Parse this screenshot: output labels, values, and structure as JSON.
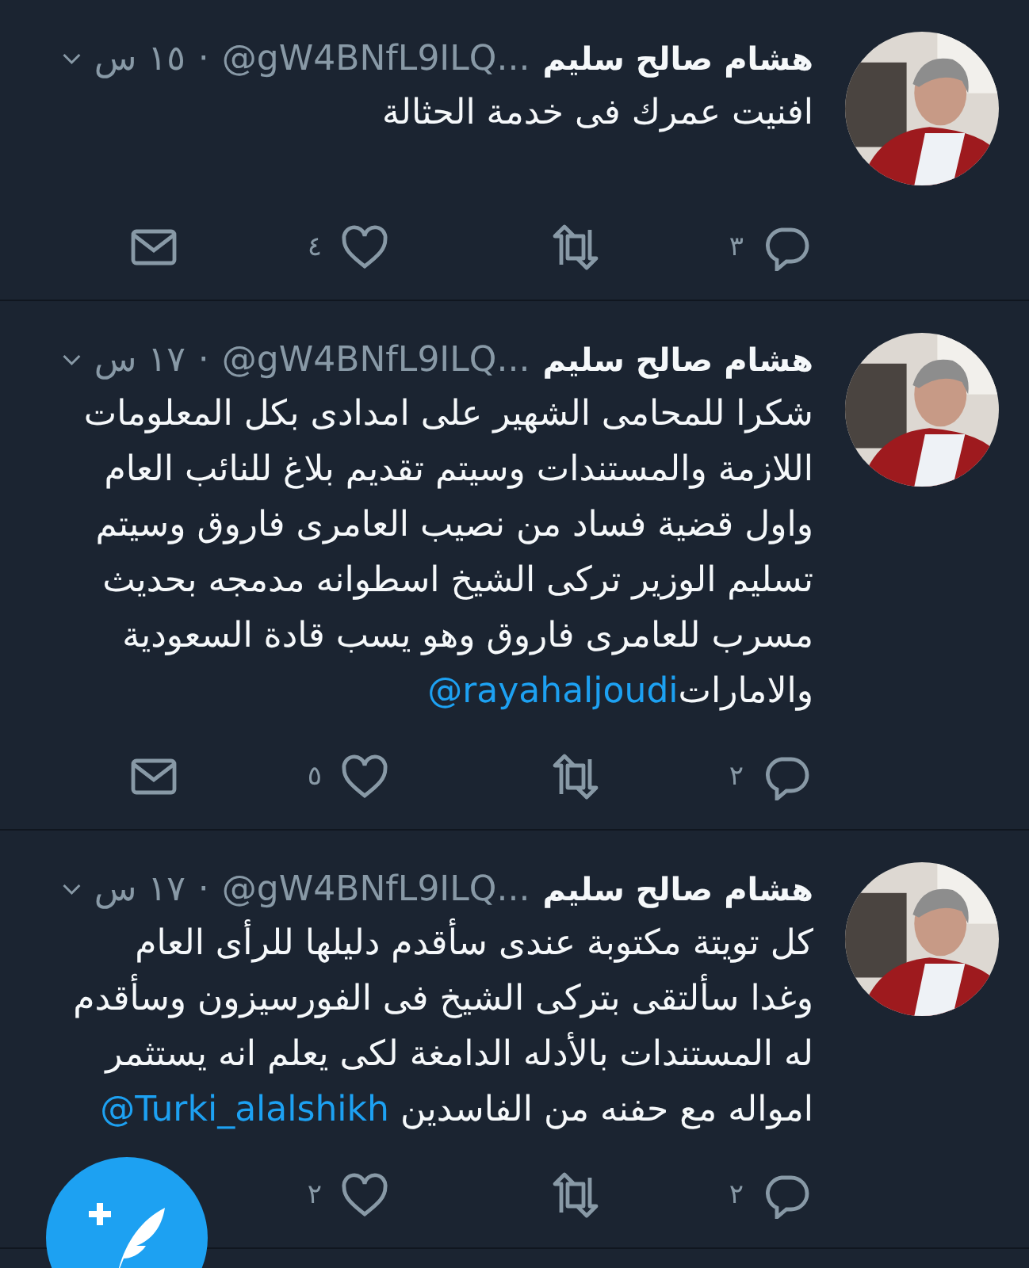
{
  "tweets": [
    {
      "author": "هشام صالح سليم",
      "handle": "@gW4BNfL9ILQ...",
      "separator": "·",
      "time": "١٥ س",
      "text": "افنيت عمرك فى خدمة الحثالة",
      "actions": [
        {
          "kind": "reply",
          "count": "٣"
        },
        {
          "kind": "retweet"
        },
        {
          "kind": "like",
          "count": "٤"
        },
        {
          "kind": "message"
        }
      ]
    },
    {
      "author": "هشام صالح سليم",
      "handle": "@gW4BNfL9ILQ...",
      "separator": "·",
      "time": "١٧ س",
      "text": "شكرا للمحامى الشهير على امدادى بكل المعلومات اللازمة والمستندات وسيتم تقديم بلاغ للنائب العام واول قضية فساد من نصيب العامرى فاروق وسيتم تسليم الوزير تركى الشيخ اسطوانه مدمجه بحديث مسرب للعامرى فاروق وهو يسب قادة السعودية والامارات",
      "mention": "@rayahaljoudi",
      "actions": [
        {
          "kind": "reply",
          "count": "٢"
        },
        {
          "kind": "retweet"
        },
        {
          "kind": "like",
          "count": "٥"
        },
        {
          "kind": "message"
        }
      ]
    },
    {
      "author": "هشام صالح سليم",
      "handle": "@gW4BNfL9ILQ...",
      "separator": "·",
      "time": "١٧ س",
      "text": "كل تويتة مكتوبة عندى سأقدم دليلها للرأى العام وغدا سألتقى بتركى الشيخ فى الفورسيزون وسأقدم له المستندات بالأدله الدامغة لكى يعلم انه يستثمر امواله مع حفنه من الفاسدين ",
      "mention": "@Turki_alalshikh",
      "actions": [
        {
          "kind": "reply",
          "count": "٢"
        },
        {
          "kind": "retweet"
        },
        {
          "kind": "like",
          "count": "٢"
        }
      ]
    }
  ]
}
